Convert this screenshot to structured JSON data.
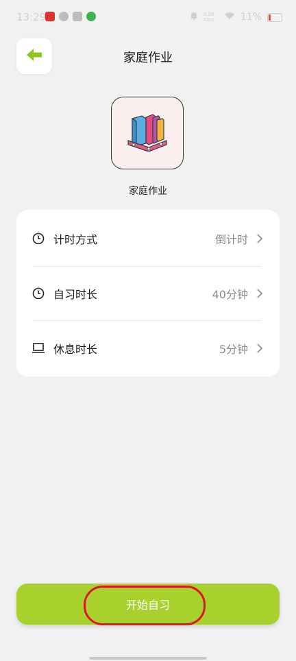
{
  "status_bar": {
    "time": "13:29",
    "network_speed": "0.20 KB/s",
    "battery_percent": "11%"
  },
  "header": {
    "back_icon": "arrow-left-icon",
    "title": "家庭作业"
  },
  "task": {
    "icon": "books-icon",
    "name": "家庭作业"
  },
  "settings": {
    "rows": [
      {
        "icon": "clock-icon",
        "label": "计时方式",
        "value": "倒计时"
      },
      {
        "icon": "clock-icon",
        "label": "自习时长",
        "value": "40分钟"
      },
      {
        "icon": "laptop-icon",
        "label": "休息时长",
        "value": "5分钟"
      }
    ]
  },
  "footer": {
    "start_label": "开始自习"
  },
  "colors": {
    "accent": "#a9d12e",
    "background": "#f0f1f0",
    "highlight": "#e0141c"
  }
}
